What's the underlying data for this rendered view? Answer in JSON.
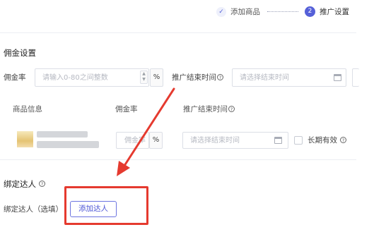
{
  "steps": {
    "step1": {
      "icon": "✓",
      "label": "添加商品"
    },
    "step2": {
      "number": "2",
      "label": "推广设置"
    }
  },
  "commission": {
    "section_title": "佣金设置",
    "rate_label": "佣金率",
    "rate_placeholder": "请输入0-80之间整数",
    "percent": "%",
    "end_time_label": "推广结束时间",
    "end_time_placeholder": "请选择结束时间"
  },
  "table": {
    "headers": [
      "商品信息",
      "佣金率",
      "推广结束时间"
    ],
    "row": {
      "rate_placeholder": "佣金率",
      "percent": "%",
      "end_time_placeholder": "请选择结束时间",
      "long_term_label": "长期有效"
    }
  },
  "bind": {
    "section_title": "绑定达人",
    "label": "绑定达人（选填）",
    "add_button": "添加达人"
  },
  "colors": {
    "accent": "#5560d8",
    "highlight": "#e53a2f"
  }
}
